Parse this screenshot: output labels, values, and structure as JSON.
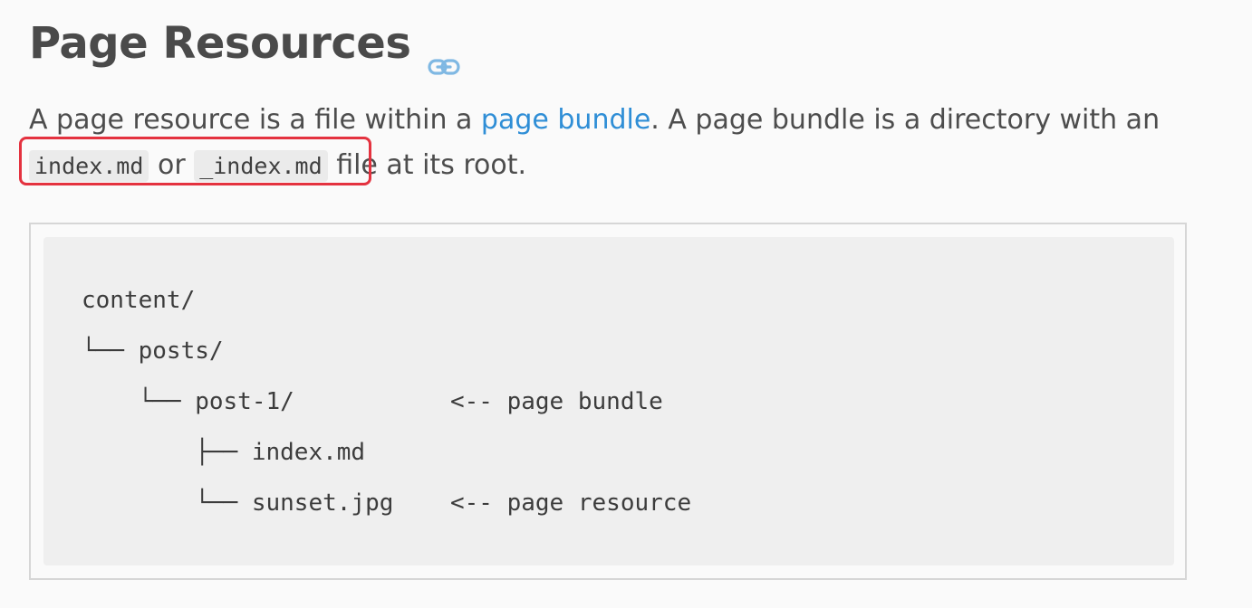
{
  "heading": {
    "title": "Page Resources",
    "anchor_icon": "link-icon"
  },
  "intro": {
    "text_before_link": "A page resource is a file within a ",
    "link_text": "page bundle",
    "text_after_link": ". A page bundle is a directory with an ",
    "code_1": "index.md",
    "middle": " or ",
    "code_2": "_index.md",
    "end": " file at its root."
  },
  "code_block": {
    "lines": [
      "content/",
      "└── posts/",
      "    └── post-1/           <-- page bundle",
      "        ├── index.md",
      "        └── sunset.jpg    <-- page resource"
    ]
  },
  "colors": {
    "link": "#2f8ed6",
    "highlight": "#e4323f",
    "heading": "#4a4a4a"
  }
}
